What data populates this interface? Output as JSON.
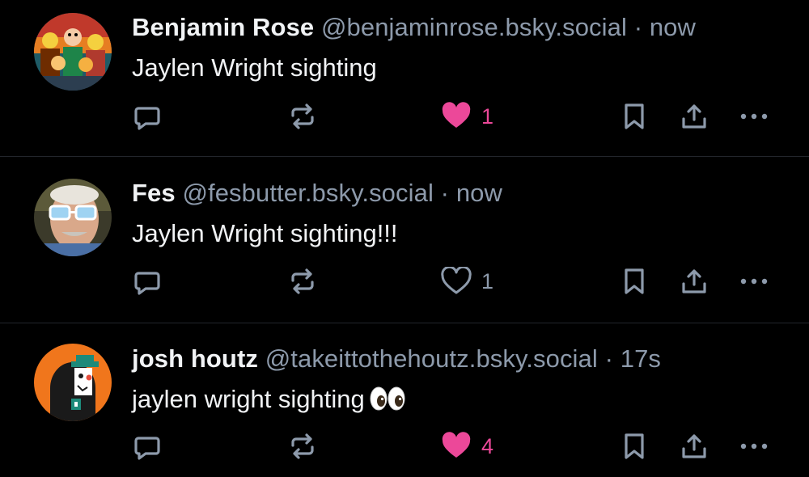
{
  "colors": {
    "background": "#000000",
    "text": "#f1f3f5",
    "muted": "#8d9aab",
    "like_active": "#ec4899",
    "divider": "#22262c"
  },
  "posts": [
    {
      "author_name": "Benjamin Rose",
      "handle": "@benjaminrose.bsky.social",
      "separator": "·",
      "time": "now",
      "text": "Jaylen Wright sighting",
      "avatar_icon": "cartoon-crowd-avatar",
      "like_count": "1",
      "liked": true
    },
    {
      "author_name": "Fes",
      "handle": "@fesbutter.bsky.social",
      "separator": "·",
      "time": "now",
      "text": "Jaylen Wright sighting!!!",
      "avatar_icon": "sunglasses-man-avatar",
      "like_count": "1",
      "liked": false
    },
    {
      "author_name": "josh houtz",
      "handle": "@takeittothehoutz.bsky.social",
      "separator": "·",
      "time": "17s",
      "text": "jaylen wright sighting",
      "emoji_icon": "eyes-emoji",
      "avatar_icon": "cartoon-character-orange-avatar",
      "like_count": "4",
      "liked": true
    }
  ],
  "action_icons": [
    "reply-icon",
    "repost-icon",
    "like-icon",
    "bookmark-icon",
    "share-icon",
    "more-icon"
  ]
}
